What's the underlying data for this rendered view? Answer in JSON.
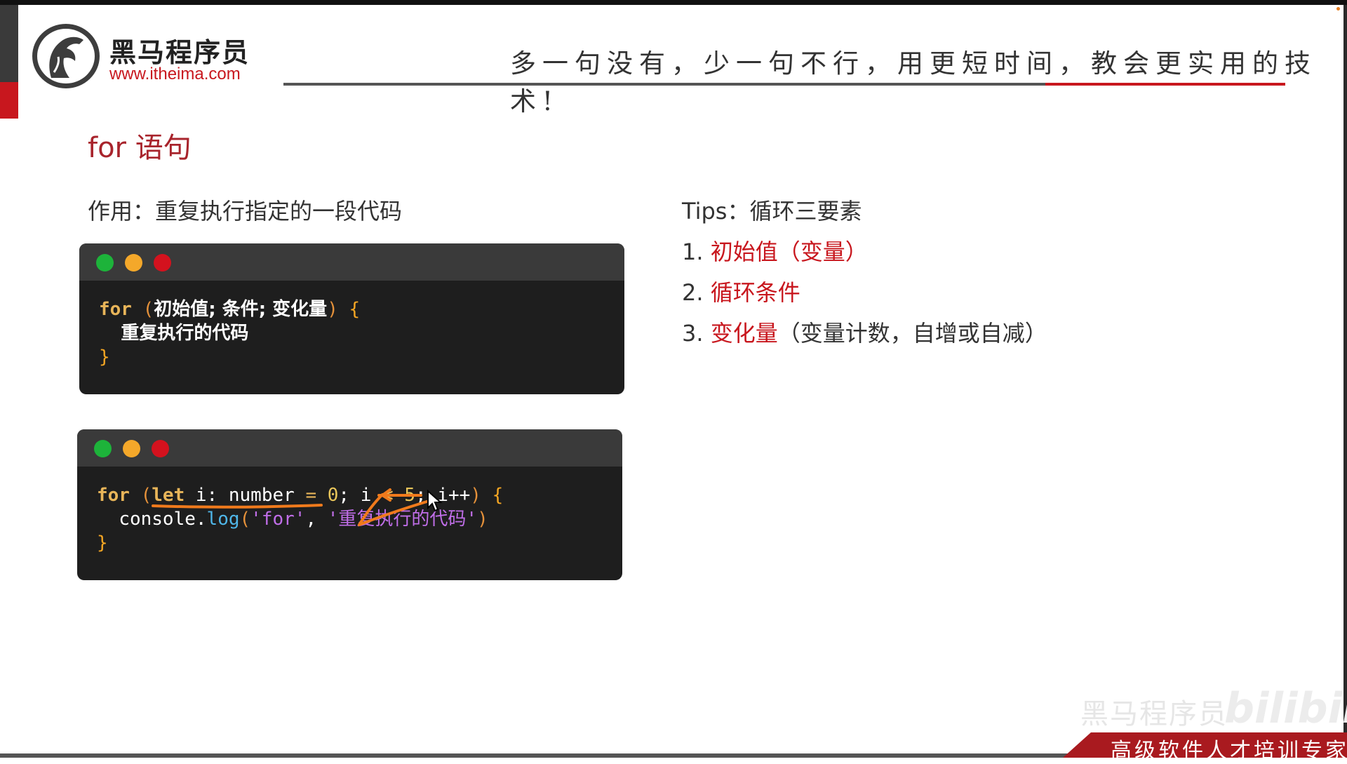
{
  "header": {
    "logo_name": "黑马程序员",
    "logo_url": "www.itheima.com",
    "slogan": "多一句没有，少一句不行，用更短时间，教会更实用的技术!"
  },
  "slide": {
    "title": "for 语句",
    "purpose": "作用：重复执行指定的一段代码"
  },
  "code_window_1": {
    "kw_for": "for",
    "paren_open": "(",
    "params": "初始值; 条件; 变化量",
    "paren_close": ")",
    "brace_open": "{",
    "body": "重复执行的代码",
    "brace_close": "}"
  },
  "code_window_2": {
    "kw_for": "for",
    "paren_open": "(",
    "kw_let": "let",
    "var_decl": " i: number ",
    "eq": "=",
    "init_num": "0",
    "mid1": "; i ",
    "lt": "<",
    "space": " ",
    "limit": "5",
    "mid2": "; i++",
    "paren_close": ")",
    "brace_open": "{",
    "obj": "console",
    "dot": ".",
    "method": "log",
    "arg_open": "(",
    "str1": "'for'",
    "comma": ", ",
    "str2": "'重复执行的代码'",
    "arg_close": ")",
    "brace_close": "}"
  },
  "tips": {
    "heading": "Tips：循环三要素",
    "items": [
      {
        "num": "1. ",
        "red": "初始值（变量）",
        "rest": ""
      },
      {
        "num": "2. ",
        "red": "循环条件",
        "rest": ""
      },
      {
        "num": "3. ",
        "red": "变化量",
        "rest": "（变量计数，自增或自减）"
      }
    ]
  },
  "footer": {
    "badge": "高级软件人才培训专家",
    "watermark": "黑马程序员",
    "bilibili": "bilibili"
  },
  "colors": {
    "accent_red": "#c8171e",
    "title_red": "#a8242c",
    "code_bg": "#1e1e1e",
    "dot_green": "#1db33a",
    "dot_yellow": "#f4a82a",
    "dot_red": "#d4121e",
    "annotation_orange": "#f07a1c"
  },
  "icons": {
    "logo": "horse-head-logo-icon",
    "cursor": "mouse-pointer-icon"
  }
}
